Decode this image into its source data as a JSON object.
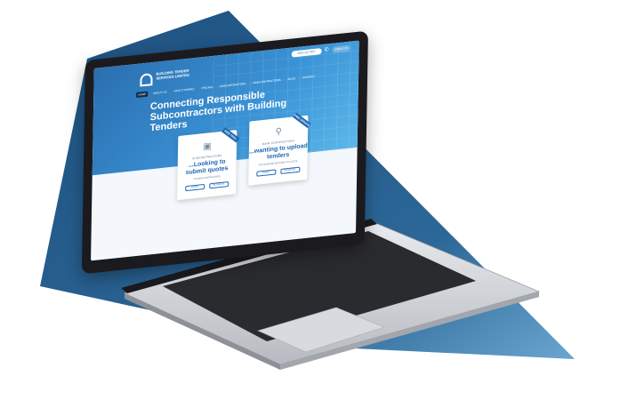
{
  "colors": {
    "bg_shape": "#1e5180",
    "bg_shape_light": "#6aa6cf",
    "hero_start": "#2a6fb0",
    "hero_end": "#5cb7ea",
    "accent": "#1f67b1"
  },
  "site": {
    "brand": "BUILDING TENDER SERVICES LIMITED",
    "phone_pill": "0800 123 4567",
    "phone_icon": "phone-icon",
    "email_pill": "EMAIL US",
    "nav": [
      "HOME",
      "ABOUT US",
      "HOW IT WORKS",
      "PRICING",
      "SUBCONTRACTORS",
      "MAIN CONTRACTORS",
      "BLOG",
      "CONTACT"
    ],
    "headline": "Connecting Responsible Subcontractors with Building Tenders",
    "cards": [
      {
        "ribbon": "FREE TRIAL",
        "icon": "toolbox-icon",
        "kicker": "SUBCONTRACTORS",
        "title": "...Looking to submit quotes",
        "subtitle": "TO MAIN CONTRACTORS",
        "btn1": "LOGIN",
        "btn2": "REGISTER"
      },
      {
        "ribbon": "FREE SERVICE",
        "icon": "wrench-icon",
        "kicker": "MAIN CONTRACTORS",
        "title": "...wanting to upload tenders",
        "subtitle": "FOR SUBCONTRACTORS TO QUOTE",
        "btn1": "LOGIN",
        "btn2": "REGISTER"
      }
    ]
  }
}
